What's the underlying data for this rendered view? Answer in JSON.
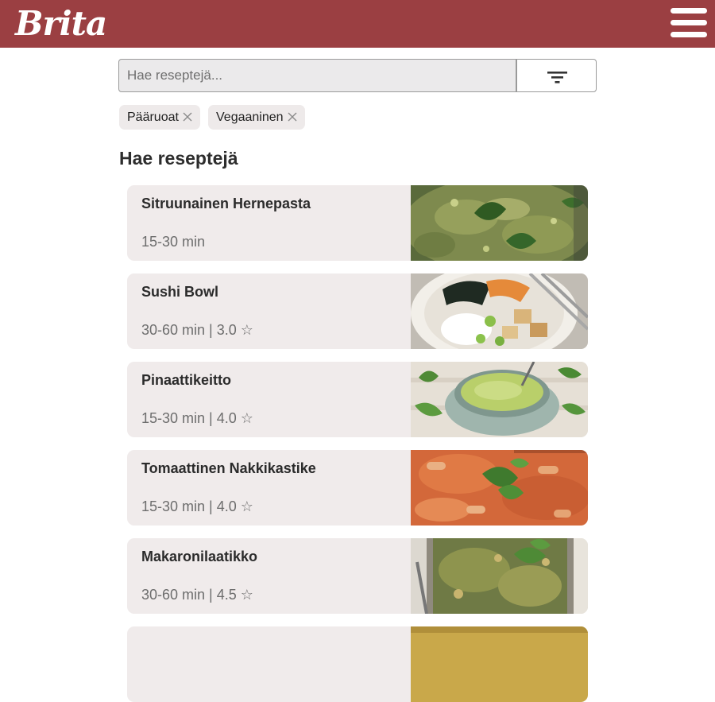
{
  "header": {
    "logo_text": "Brita",
    "brand_color": "#9b3f42",
    "menu_icon": "hamburger-menu-icon"
  },
  "search": {
    "placeholder": "Hae reseptejä...",
    "value": "",
    "filter_icon": "filter-icon"
  },
  "filters": [
    {
      "label": "Pääruoat",
      "remove_icon": "close-icon"
    },
    {
      "label": "Vegaaninen",
      "remove_icon": "close-icon"
    }
  ],
  "section_title": "Hae reseptejä",
  "recipes": [
    {
      "title": "Sitruunainen Hernepasta",
      "meta": "15-30 min",
      "image": "pasta-photo"
    },
    {
      "title": "Sushi Bowl",
      "meta": "30-60 min | 3.0 ☆",
      "image": "sushi-bowl-photo"
    },
    {
      "title": "Pinaattikeitto",
      "meta": "15-30 min | 4.0 ☆",
      "image": "spinach-soup-photo"
    },
    {
      "title": "Tomaattinen Nakkikastike",
      "meta": "15-30 min | 4.0 ☆",
      "image": "sausage-sauce-photo"
    },
    {
      "title": "Makaronilaatikko",
      "meta": "30-60 min | 4.5 ☆",
      "image": "macaroni-casserole-photo"
    }
  ]
}
